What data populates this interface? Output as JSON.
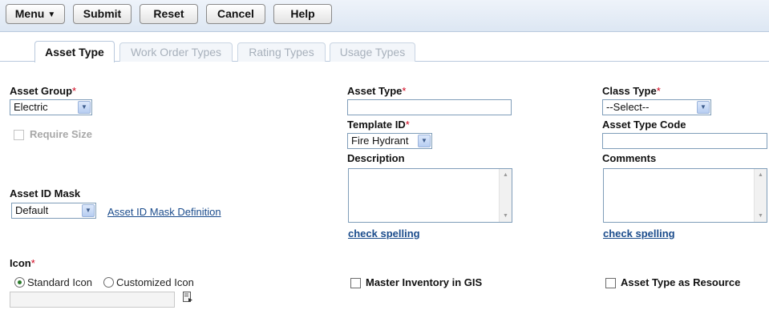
{
  "toolbar": {
    "menu": "Menu",
    "submit": "Submit",
    "reset": "Reset",
    "cancel": "Cancel",
    "help": "Help"
  },
  "tabs": [
    {
      "label": "Asset Type",
      "active": true
    },
    {
      "label": "Work Order Types",
      "active": false
    },
    {
      "label": "Rating Types",
      "active": false
    },
    {
      "label": "Usage Types",
      "active": false
    }
  ],
  "form": {
    "asset_group": {
      "label": "Asset Group",
      "value": "Electric"
    },
    "require_size": {
      "label": "Require Size",
      "checked": false,
      "disabled": true
    },
    "asset_id_mask": {
      "label": "Asset ID Mask",
      "value": "Default",
      "link": "Asset ID Mask Definition"
    },
    "icon": {
      "label": "Icon",
      "standard": "Standard Icon",
      "customized": "Customized Icon",
      "selected": "standard",
      "path_value": ""
    },
    "asset_type": {
      "label": "Asset Type",
      "value": ""
    },
    "template_id": {
      "label": "Template ID",
      "value": "Fire Hydrant"
    },
    "description": {
      "label": "Description",
      "value": "",
      "spell_link": "check spelling"
    },
    "master_inventory": {
      "label": "Master Inventory in GIS",
      "checked": false
    },
    "class_type": {
      "label": "Class Type",
      "value": "--Select--"
    },
    "asset_type_code": {
      "label": "Asset Type Code",
      "value": ""
    },
    "comments": {
      "label": "Comments",
      "value": "",
      "spell_link": "check spelling"
    },
    "asset_type_resource": {
      "label": "Asset Type as Resource",
      "checked": false
    },
    "required_mark": "*"
  },
  "colors": {
    "required": "#d0021b",
    "link": "#1b4c8c",
    "toolbar_bg": "#dde7f3",
    "radio_selected": "#2a7a2a"
  }
}
